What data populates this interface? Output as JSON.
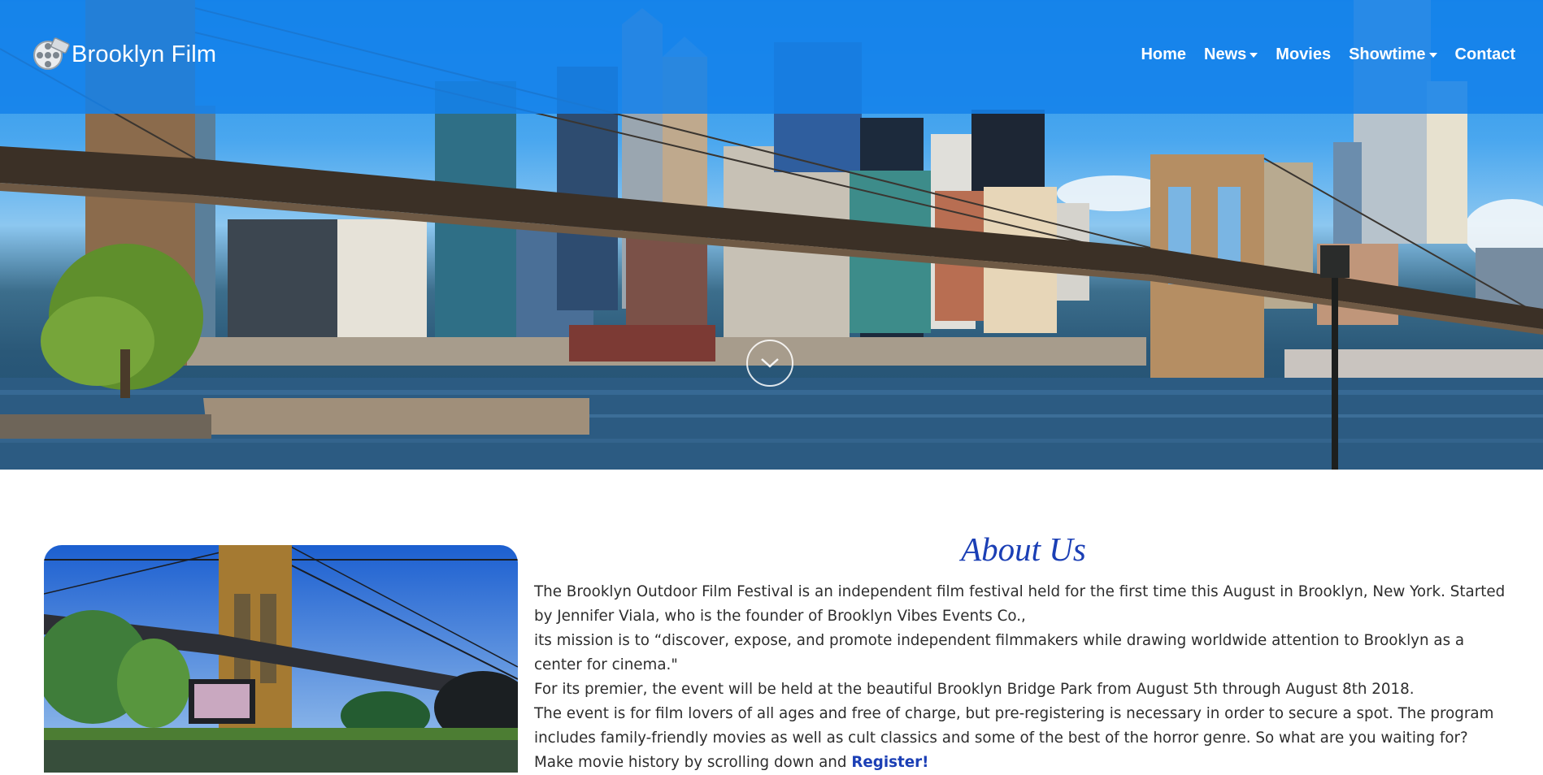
{
  "brand": {
    "name": "Brooklyn Film",
    "logo_icon": "film-reel-icon"
  },
  "nav": {
    "items": [
      {
        "label": "Home",
        "dropdown": false
      },
      {
        "label": "News",
        "dropdown": true
      },
      {
        "label": "Movies",
        "dropdown": false
      },
      {
        "label": "Showtime",
        "dropdown": true
      },
      {
        "label": "Contact",
        "dropdown": false
      }
    ]
  },
  "hero": {
    "image": "brooklyn-bridge-skyline-photo",
    "scroll_icon": "chevron-down-icon"
  },
  "about": {
    "title": "About Us",
    "image": "brooklyn-bridge-park-outdoor-screening-photo",
    "paragraphs": [
      "The Brooklyn Outdoor Film Festival is an independent film festival held for the first time this August in Brooklyn, New York. Started by Jennifer Viala, who is the founder of Brooklyn Vibes Events Co.,",
      "its mission is to “discover, expose, and promote independent filmmakers while drawing worldwide attention to Brooklyn as a center for cinema.\"",
      "For its premier, the event will be held at the beautiful Brooklyn Bridge Park from August 5th through August 8th 2018.",
      "The event is for film lovers of all ages and free of charge, but pre-registering is necessary in order to secure a spot. The program includes family-friendly movies as well as cult classics and some of the best of the horror genre. So what are you waiting for? Make movie history by scrolling down and "
    ],
    "register_link": "Register!"
  },
  "colors": {
    "navbar": "#1482eb",
    "title_blue": "#1b3fb5",
    "body_text": "#2d2d2d"
  }
}
